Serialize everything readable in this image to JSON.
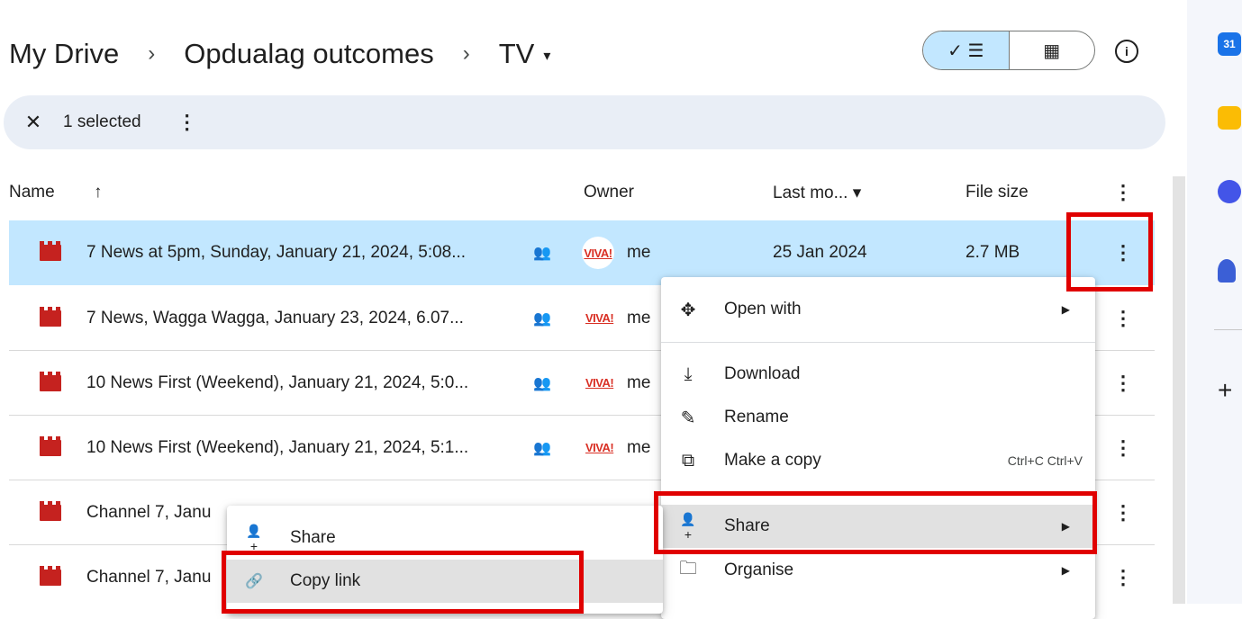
{
  "breadcrumb": {
    "items": [
      "My Drive",
      "Opdualag outcomes",
      "TV"
    ],
    "separator": "›",
    "caret": "▾"
  },
  "view_toggle": {
    "list_label": "✓ ☰",
    "grid_label": "▦"
  },
  "info_label": "i",
  "selection_bar": {
    "close": "✕",
    "count_label": "1 selected",
    "more": "⋮"
  },
  "columns": {
    "name": "Name",
    "sort_arrow": "↑",
    "owner": "Owner",
    "last_modified": "Last mo... ▾",
    "file_size": "File size",
    "more": "⋮"
  },
  "rows": [
    {
      "name": "7 News at 5pm, Sunday, January 21, 2024, 5:08...",
      "owner": "me",
      "owner_badge": "VIVA!",
      "modified": "25 Jan 2024",
      "size": "2.7 MB",
      "selected": true
    },
    {
      "name": "7 News, Wagga Wagga, January 23, 2024, 6.07...",
      "owner": "me",
      "owner_badge": "VIVA!",
      "modified": "",
      "size": ""
    },
    {
      "name": "10 News First (Weekend), January 21, 2024, 5:0...",
      "owner": "me",
      "owner_badge": "VIVA!",
      "modified": "",
      "size": ""
    },
    {
      "name": "10 News First (Weekend), January 21, 2024, 5:1...",
      "owner": "me",
      "owner_badge": "VIVA!",
      "modified": "",
      "size": ""
    },
    {
      "name": "Channel 7, Janu",
      "owner": "",
      "owner_badge": "",
      "modified": "",
      "size": ""
    },
    {
      "name": "Channel 7, Janu",
      "owner": "",
      "owner_badge": "",
      "modified": "",
      "size": ""
    }
  ],
  "shared_glyph": "👥",
  "kebab": "⋮",
  "context_menu": {
    "items": [
      {
        "label": "Open with",
        "icon": "move-icon",
        "glyph": "✥",
        "arrow": "▶"
      },
      {
        "label": "Download",
        "icon": "download-icon",
        "glyph": "⤓"
      },
      {
        "label": "Rename",
        "icon": "rename-icon",
        "glyph": "✎"
      },
      {
        "label": "Make a copy",
        "icon": "copy-icon",
        "glyph": "⧉",
        "shortcut": "Ctrl+C Ctrl+V"
      },
      {
        "label": "Share",
        "icon": "person-add-icon",
        "glyph": "👤+",
        "arrow": "▶"
      },
      {
        "label": "Organise",
        "icon": "folder-icon",
        "glyph": "🗀",
        "arrow": "▶"
      }
    ]
  },
  "share_submenu": {
    "items": [
      {
        "label": "Share",
        "icon": "person-add-icon",
        "glyph": "👤+"
      },
      {
        "label": "Copy link",
        "icon": "link-icon",
        "glyph": "🔗"
      }
    ]
  },
  "side_panel": {
    "calendar_label": "31",
    "add": "+"
  },
  "colors": {
    "selected_row": "#c2e7ff",
    "selection_bar": "#e9eef6",
    "highlight_box": "#e00000",
    "video_icon": "#c5221f"
  }
}
